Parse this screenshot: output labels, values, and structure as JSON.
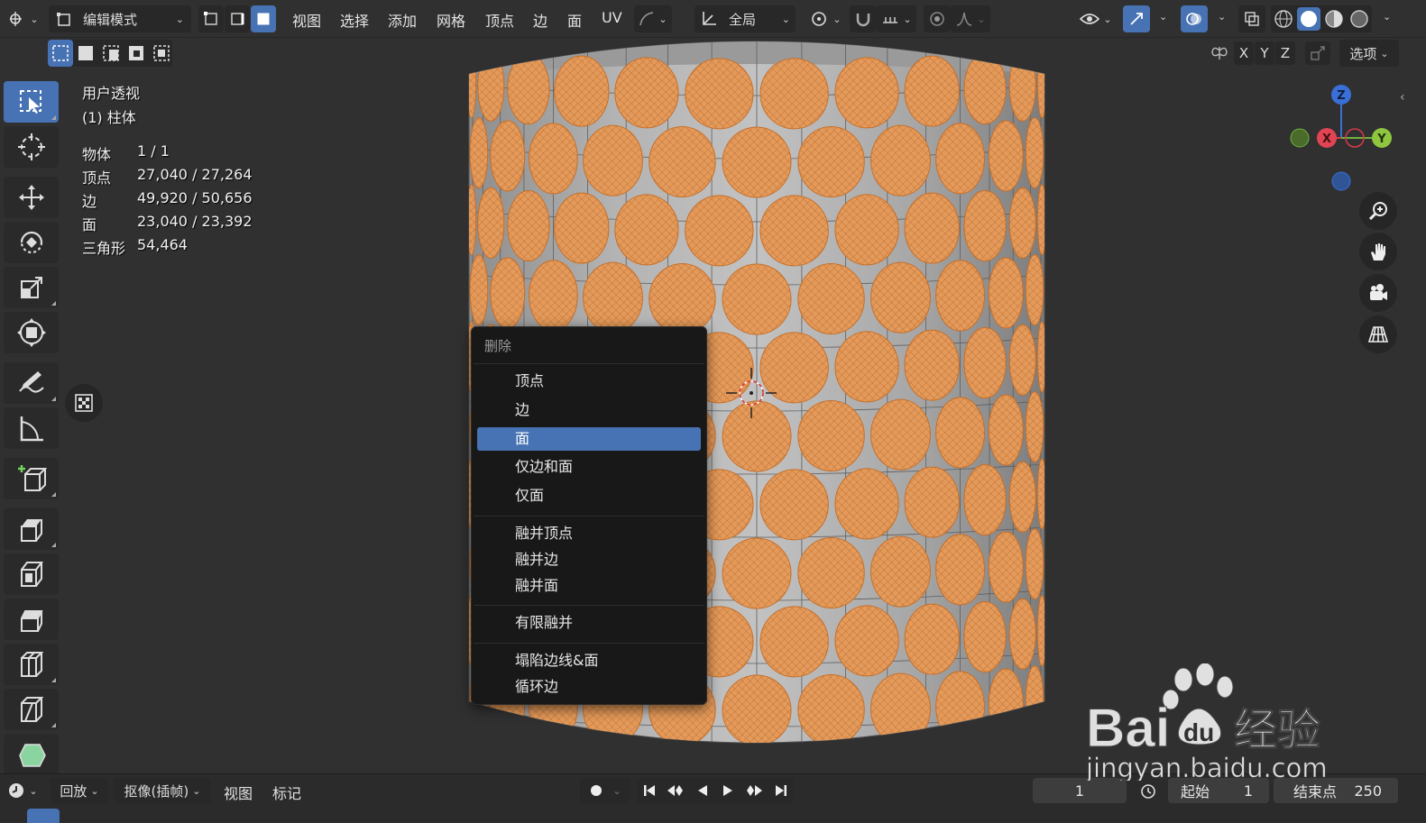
{
  "header": {
    "editor_type_icon": "editor-type-icon",
    "mode_label": "编辑模式",
    "menus": [
      "视图",
      "选择",
      "添加",
      "网格",
      "顶点",
      "边",
      "面",
      "UV"
    ],
    "orientation_label": "全局",
    "options_label": "选项",
    "axis_x": "X",
    "axis_y": "Y",
    "axis_z": "Z"
  },
  "stats": {
    "view_name": "用户透视",
    "object_name": "(1) 柱体",
    "rows": [
      {
        "label": "物体",
        "value": "1 / 1"
      },
      {
        "label": "顶点",
        "value": "27,040 / 27,264"
      },
      {
        "label": "边",
        "value": "49,920 / 50,656"
      },
      {
        "label": "面",
        "value": "23,040 / 23,392"
      },
      {
        "label": "三角形",
        "value": "54,464"
      }
    ]
  },
  "context_menu": {
    "title": "删除",
    "items": [
      "顶点",
      "边",
      "面",
      "仅边和面",
      "仅面",
      "融并顶点",
      "融并边",
      "融并面",
      "有限融并",
      "塌陷边线&面",
      "循环边"
    ],
    "highlighted": "面"
  },
  "gizmo": {
    "z": "Z",
    "x": "X",
    "y": "Y"
  },
  "timeline": {
    "playback_label": "回放",
    "keying_label": "抠像(插帧)",
    "view_label": "视图",
    "marker_label": "标记",
    "current_frame": "1",
    "start_label": "起始",
    "start_value": "1",
    "end_label": "结束点",
    "end_value": "250"
  },
  "watermark": {
    "brand": "Bai",
    "brand2": "du",
    "brand3": "经验",
    "url": "jingyan.baidu.com"
  },
  "colors": {
    "accent": "#4772b3",
    "selected_face": "#e8a055",
    "background": "#303030",
    "menu_bg": "#181818"
  }
}
